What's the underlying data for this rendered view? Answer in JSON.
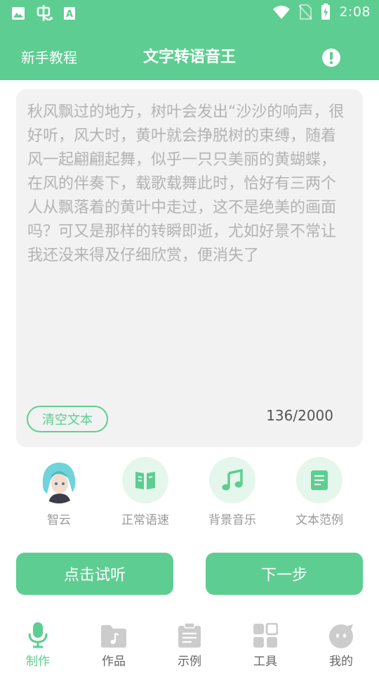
{
  "status_bar": {
    "time": "2:08",
    "icons": [
      "image-icon",
      "bug-icon",
      "a-icon",
      "wifi-icon",
      "no-sim-icon",
      "battery-charging-icon"
    ]
  },
  "header": {
    "tutorial_label": "新手教程",
    "title": "文字转语音王",
    "info_icon": "exclamation-icon"
  },
  "editor": {
    "text": "秋风飘过的地方，树叶会发出“沙沙的响声，很好听，风大时，黄叶就会挣脱树的束缚，随着风一起翩翩起舞，似乎一只只美丽的黄蝴蝶，在风的伴奏下，载歌载舞此时，恰好有三两个人从飘落着的黄叶中走过，这不是绝美的画面吗？可又是那样的转瞬即逝，尤如好景不常让我还没来得及仔细欣赏，便消失了",
    "clear_label": "清空文本",
    "counter": "136/2000"
  },
  "tools": [
    {
      "label": "智云",
      "icon": "voice-avatar"
    },
    {
      "label": "正常语速",
      "icon": "book-icon"
    },
    {
      "label": "背景音乐",
      "icon": "music-note-icon"
    },
    {
      "label": "文本范例",
      "icon": "document-icon"
    }
  ],
  "actions": {
    "preview_label": "点击试听",
    "next_label": "下一步"
  },
  "tabs": [
    {
      "label": "制作",
      "icon": "microphone-icon",
      "active": true
    },
    {
      "label": "作品",
      "icon": "folder-music-icon",
      "active": false
    },
    {
      "label": "示例",
      "icon": "clipboard-icon",
      "active": false
    },
    {
      "label": "工具",
      "icon": "grid-icon",
      "active": false
    },
    {
      "label": "我的",
      "icon": "face-icon",
      "active": false
    }
  ],
  "colors": {
    "accent": "#5ecd91",
    "accent_light": "#e5f7ed",
    "card_bg": "#f2f2f2",
    "inactive_icon": "#cccccc"
  }
}
